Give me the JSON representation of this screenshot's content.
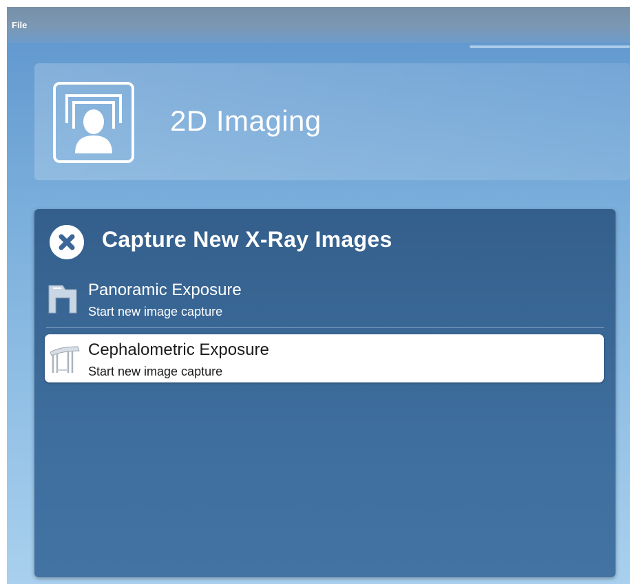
{
  "menubar": {
    "file_label": "File"
  },
  "header": {
    "title": "2D Imaging",
    "icon": "patient-portrait-icon"
  },
  "capture": {
    "title": "Capture New X-Ray Images",
    "close_icon": "close-icon",
    "options": [
      {
        "label": "Panoramic Exposure",
        "subtitle": "Start new image capture",
        "icon": "panoramic-device-icon",
        "selected": false
      },
      {
        "label": "Cephalometric Exposure",
        "subtitle": "Start new image capture",
        "icon": "cephalometric-device-icon",
        "selected": true
      }
    ]
  },
  "colors": {
    "background_top": "#5d95cd",
    "panel": "#3e6e9d",
    "selected_row": "#ffffff",
    "text_light": "#ffffff",
    "text_dark": "#1a1a1a"
  }
}
